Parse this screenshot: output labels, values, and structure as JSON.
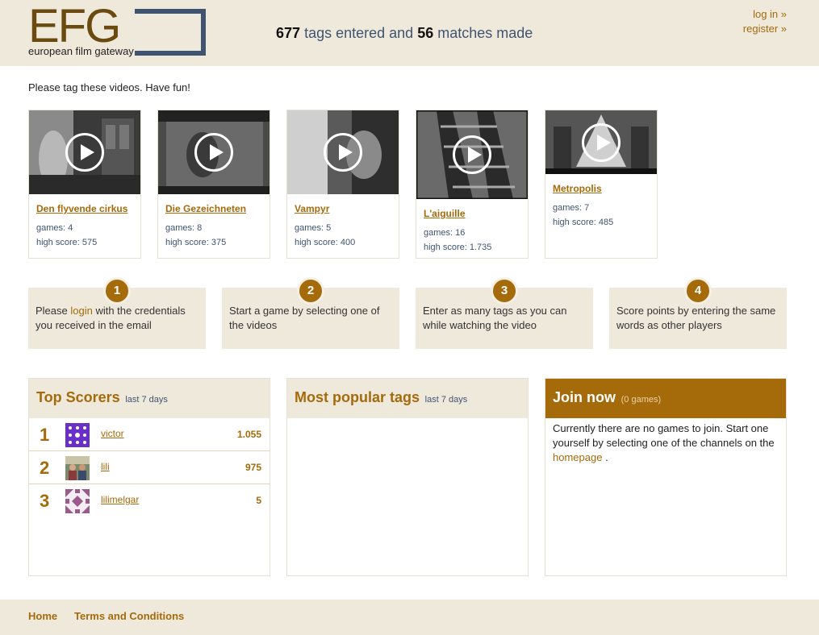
{
  "header": {
    "logo_text": "EFG",
    "logo_subtitle": "european film gateway",
    "tags_count": "677",
    "tags_label": "tags entered and",
    "matches_count": "56",
    "matches_label": "matches made",
    "login_link": "log in »",
    "register_link": "register »"
  },
  "intro": "Please tag these videos. Have fun!",
  "videos": [
    {
      "title": "Den flyvende cirkus",
      "games": "games: 4",
      "high_score": "high score: 575"
    },
    {
      "title": "Die Gezeichneten",
      "games": "games: 8",
      "high_score": "high score: 375"
    },
    {
      "title": "Vampyr",
      "games": "games: 5",
      "high_score": "high score: 400"
    },
    {
      "title": "L'aiguille",
      "games": "games: 16",
      "high_score": "high score: 1.735"
    },
    {
      "title": "Metropolis",
      "games": "games: 7",
      "high_score": "high score: 485"
    }
  ],
  "steps": [
    {
      "num": "1",
      "text_before": "Please ",
      "link": "login",
      "text_after": " with the credentials you received in the email"
    },
    {
      "num": "2",
      "text": "Start a game by selecting one of the videos"
    },
    {
      "num": "3",
      "text": "Enter as many tags as you can while watching the video"
    },
    {
      "num": "4",
      "text": "Score points by entering the same words as other players"
    }
  ],
  "top_scorers": {
    "title": "Top Scorers",
    "period": "last 7 days",
    "rows": [
      {
        "rank": "1",
        "name": "victor",
        "score": "1.055"
      },
      {
        "rank": "2",
        "name": "lili",
        "score": "975"
      },
      {
        "rank": "3",
        "name": "lilimelgar",
        "score": "5"
      }
    ]
  },
  "popular_tags": {
    "title": "Most popular tags",
    "period": "last 7 days"
  },
  "join": {
    "title": "Join now",
    "count": "(0 games)",
    "text": "Currently there are no games to join. Start one yourself by selecting one of the channels on the",
    "link": "homepage",
    "text_end": "."
  },
  "footer": {
    "home": "Home",
    "terms": "Terms and Conditions"
  },
  "colors": {
    "accent": "#a56a0a",
    "beige": "#efe9dc",
    "navy": "#3f5471"
  }
}
